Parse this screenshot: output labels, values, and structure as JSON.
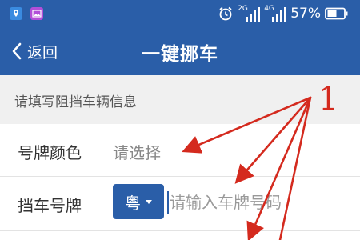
{
  "status_bar": {
    "network1": "2G",
    "network2": "4G",
    "battery": "57%",
    "colors": {
      "bg": "#2a5ea8"
    },
    "icons": [
      "location-app-icon",
      "gallery-app-icon",
      "alarm-icon",
      "signal-icon",
      "battery-icon"
    ]
  },
  "header": {
    "back_label": "返回",
    "title": "一键挪车"
  },
  "form": {
    "section_title": "请填写阻挡车辆信息",
    "plate_color_label": "号牌颜色",
    "plate_color_value": "请选择",
    "plate_number_label": "挡车号牌",
    "province": "粤",
    "plate_placeholder": "请输入车牌号码"
  },
  "annotation": {
    "number": "1",
    "color": "#d42a1e"
  }
}
